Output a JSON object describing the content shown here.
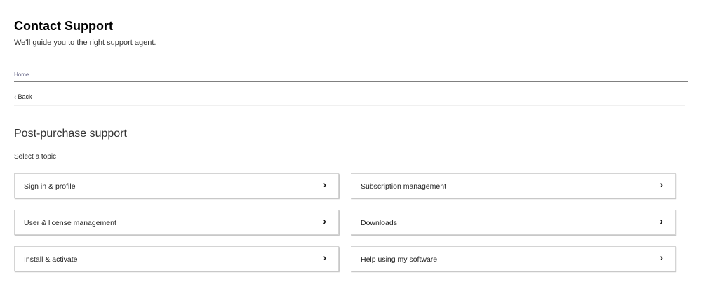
{
  "header": {
    "title": "Contact Support",
    "subtitle": "We'll guide you to the right support agent."
  },
  "breadcrumb": {
    "home": "Home"
  },
  "nav": {
    "back": "Back",
    "back_icon": "chevron-left-icon"
  },
  "main": {
    "section_title": "Post-purchase support",
    "prompt": "Select a topic",
    "topics": [
      {
        "label": "Sign in & profile"
      },
      {
        "label": "Subscription management"
      },
      {
        "label": "User & license management"
      },
      {
        "label": "Downloads"
      },
      {
        "label": "Install & activate"
      },
      {
        "label": "Help using my software"
      }
    ],
    "chevron": "›"
  }
}
